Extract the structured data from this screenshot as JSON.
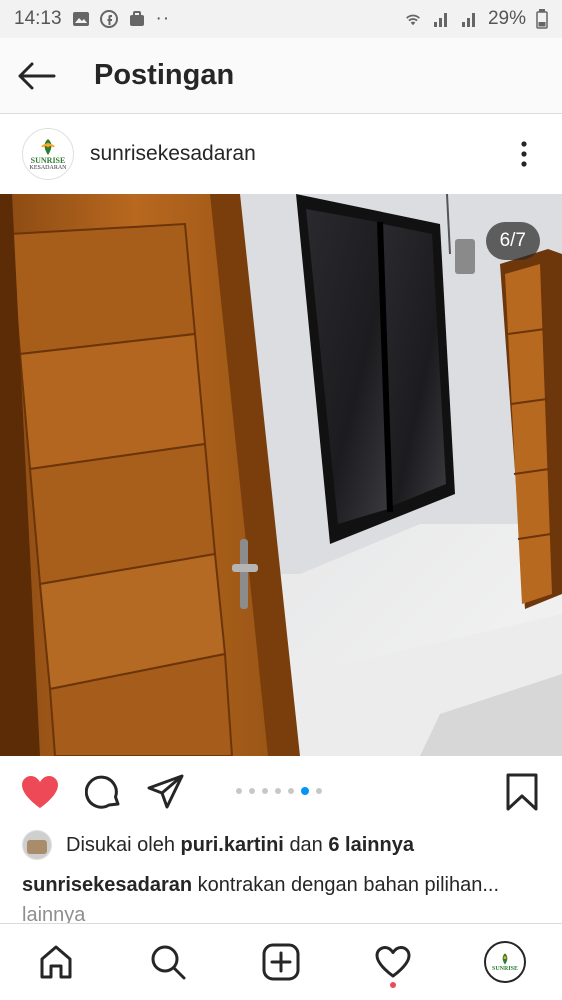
{
  "status_bar": {
    "time": "14:13",
    "battery": "29%"
  },
  "topbar": {
    "title": "Postingan"
  },
  "post": {
    "username": "sunrisekesadaran",
    "avatar_text": "SUNRISE",
    "avatar_sub": "KESADARAN",
    "image_counter": "6/7",
    "carousel": {
      "count": 7,
      "active": 6
    }
  },
  "likes": {
    "prefix": "Disukai oleh",
    "user": "puri.kartini",
    "connector": "dan",
    "others": "6 lainnya"
  },
  "caption": {
    "username": "sunrisekesadaran",
    "text": "kontrakan dengan bahan pilihan...",
    "more": "lainnya"
  },
  "colors": {
    "like": "#ed4956",
    "accent": "#0095f6"
  },
  "icons": {
    "actions": [
      "heart-icon",
      "comment-icon",
      "share-icon",
      "bookmark-icon"
    ],
    "nav": [
      "home-icon",
      "search-icon",
      "add-icon",
      "activity-icon",
      "profile-avatar"
    ]
  }
}
